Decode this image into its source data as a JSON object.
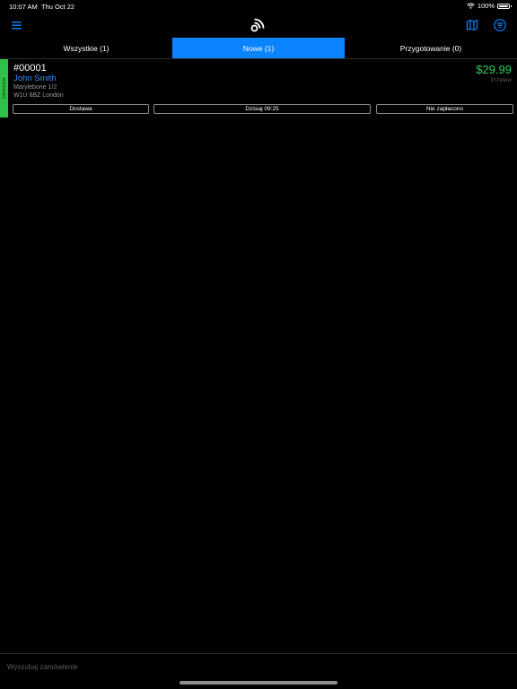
{
  "status_bar": {
    "time": "10:07 AM",
    "date": "Thu Oct 22",
    "battery": "100%"
  },
  "nav": {
    "icons": {
      "menu": "menu-icon",
      "logo": "rss-feed-logo-icon",
      "map": "map-icon",
      "filter": "filter-icon"
    },
    "accent_color": "#0a84ff"
  },
  "tabs": [
    {
      "label": "Wszystkie (1)",
      "active": false
    },
    {
      "label": "Nowe (1)",
      "active": true
    },
    {
      "label": "Przygotowanie (0)",
      "active": false
    }
  ],
  "order": {
    "status_label": "Utworzone",
    "status_color": "#30c048",
    "number": "#00001",
    "customer": "John Smith",
    "address_line1": "Marylebone 1/2",
    "address_line2": "W1U 6BZ London",
    "total": "$29.99",
    "payment_method": "Przelew",
    "chips": {
      "delivery": "Dostawa",
      "time": "Dzisiaj 09:25",
      "payment_status": "Nie zapłacono"
    }
  },
  "search": {
    "placeholder": "Wyszukaj zamówienie"
  }
}
